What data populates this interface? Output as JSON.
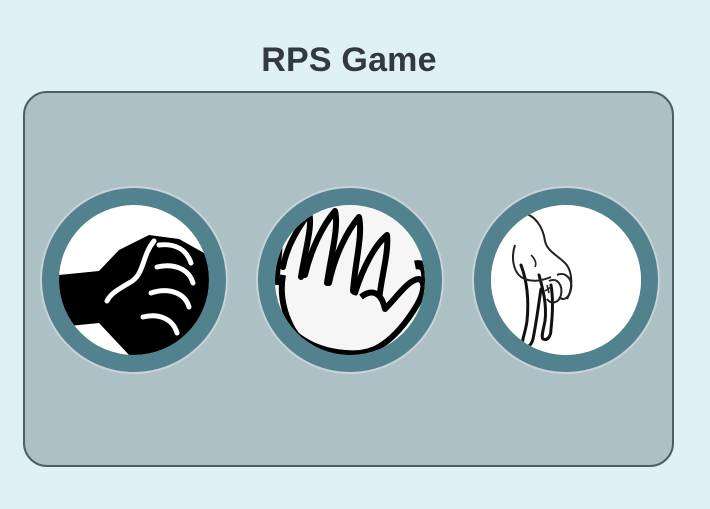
{
  "title": "RPS Game",
  "choices": [
    {
      "id": "rock",
      "icon": "rock-fist-icon"
    },
    {
      "id": "paper",
      "icon": "paper-hand-icon"
    },
    {
      "id": "scissors",
      "icon": "scissors-hand-icon"
    }
  ],
  "colors": {
    "page_background": "#e0f0f7",
    "board_background": "#acc0c6",
    "board_border": "#4b5f68",
    "choice_ring": "#52828e",
    "title_text": "#333a3f"
  }
}
